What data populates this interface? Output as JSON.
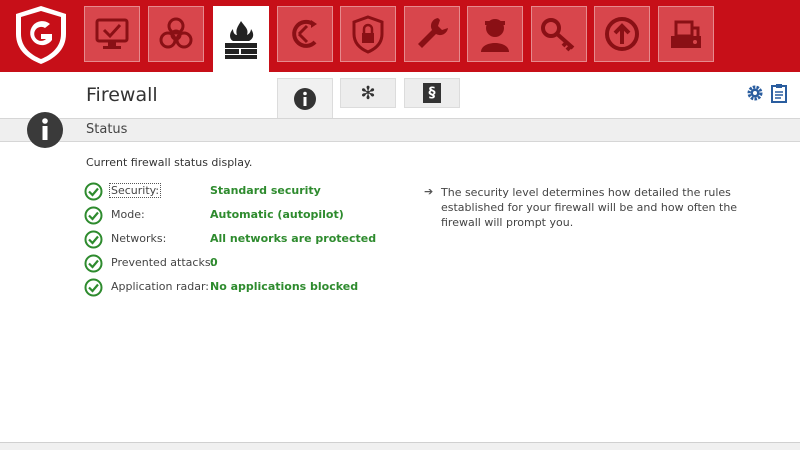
{
  "app": {
    "page_title": "Firewall",
    "section_label": "Status",
    "description": "Current firewall status display.",
    "accent_color": "#c70f18",
    "ok_color": "#2e8b2e"
  },
  "nav": {
    "items": [
      {
        "icon": "monitor-check-icon"
      },
      {
        "icon": "biohazard-icon"
      },
      {
        "icon": "firewall-icon",
        "active": true
      },
      {
        "icon": "anti-ransomware-icon"
      },
      {
        "icon": "shield-lock-icon"
      },
      {
        "icon": "wrench-icon"
      },
      {
        "icon": "parental-control-icon"
      },
      {
        "icon": "key-icon"
      },
      {
        "icon": "backup-upload-icon"
      },
      {
        "icon": "device-control-icon"
      }
    ]
  },
  "subtabs": {
    "items": [
      {
        "icon": "info-icon",
        "glyph": "i",
        "active": true
      },
      {
        "icon": "snowflake-icon",
        "glyph": "✻"
      },
      {
        "icon": "section-icon",
        "glyph": "§"
      }
    ]
  },
  "status": {
    "rows": [
      {
        "label": "Security:",
        "value": "Standard security"
      },
      {
        "label": "Mode:",
        "value": "Automatic (autopilot)"
      },
      {
        "label": "Networks:",
        "value": "All networks are protected"
      },
      {
        "label": "Prevented attacks:",
        "value": "0"
      },
      {
        "label": "Application radar:",
        "value": "No applications blocked"
      }
    ]
  },
  "hint": {
    "arrow": "➔",
    "text": "The security level determines how detailed the rules established for your firewall will be and how often the firewall will prompt you."
  }
}
